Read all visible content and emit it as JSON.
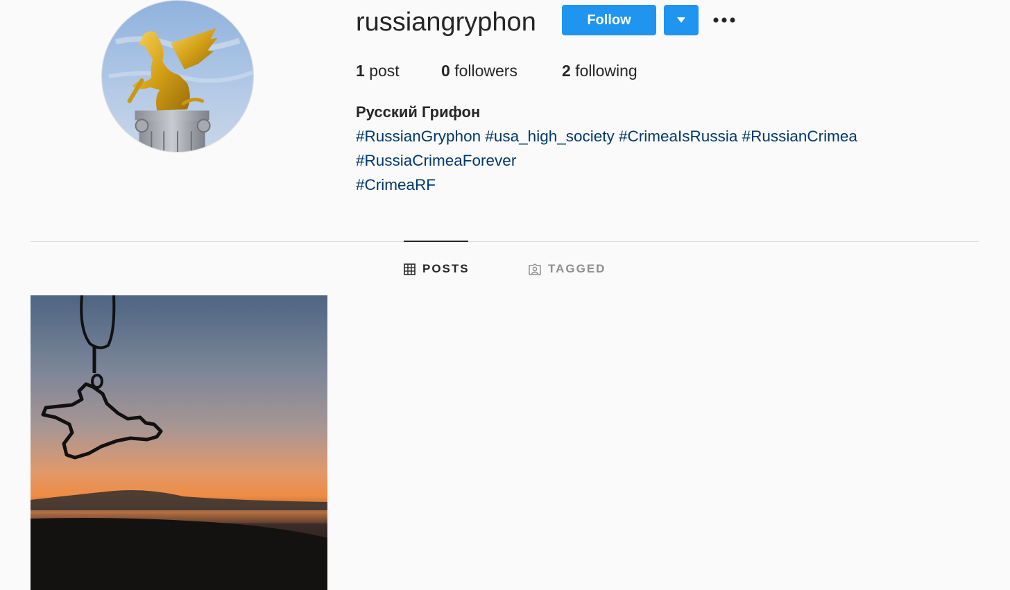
{
  "profile": {
    "username": "russiangryphon",
    "follow_label": "Follow",
    "icons": {
      "dropdown": "caret-down-icon",
      "more": "more-options-icon",
      "avatar": "golden-gryphon-statue",
      "post": "crimea-pendant-sunset"
    },
    "stats": {
      "posts_count": "1",
      "posts_label": "post",
      "followers_count": "0",
      "followers_label": "followers",
      "following_count": "2",
      "following_label": "following"
    },
    "full_name": "Русский Грифон",
    "bio_lines": [
      [
        "#RussianGryphon",
        "#usa_high_society",
        "#CrimeaIsRussia",
        "#RussianCrimea"
      ],
      [
        "#RussiaCrimeaForever"
      ],
      [
        "#CrimeaRF"
      ]
    ]
  },
  "tabs": {
    "posts_label": "POSTS",
    "tagged_label": "TAGGED",
    "active": "posts"
  },
  "colors": {
    "accent": "#1f95f0",
    "hashtag": "#00376b",
    "text": "#262626",
    "muted": "#8e8e8e",
    "background": "#fafafa"
  }
}
